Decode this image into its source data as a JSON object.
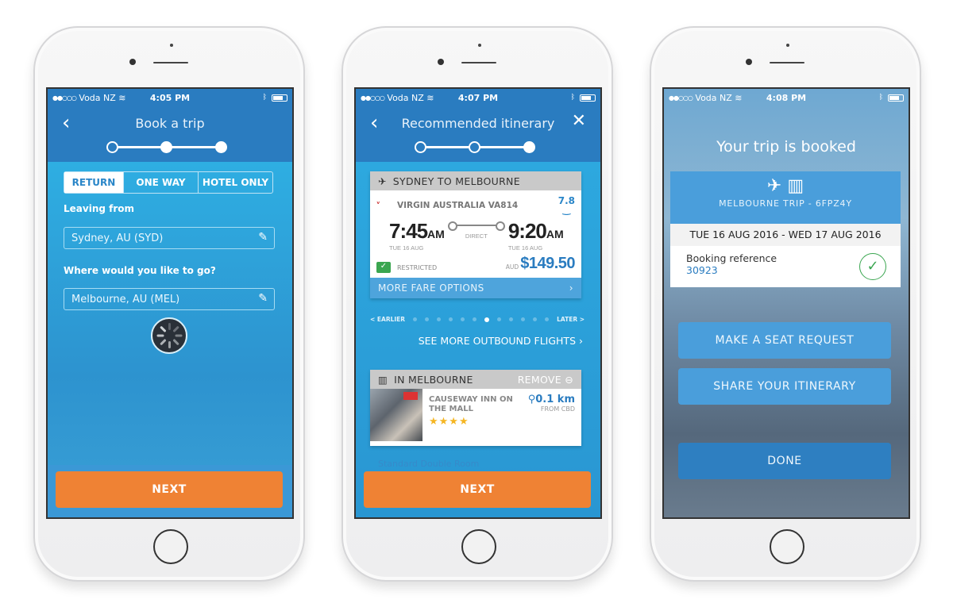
{
  "phones": [
    {
      "status": {
        "carrier": "Voda NZ",
        "time": "4:05 PM"
      },
      "nav": {
        "title": "Book a trip",
        "back_icon": "chevron-left"
      },
      "stepper": {
        "current_step": 1,
        "total_steps": 3
      },
      "trip_type": {
        "options": [
          "RETURN",
          "ONE WAY",
          "HOTEL ONLY"
        ],
        "selected": "RETURN"
      },
      "leaving_label": "Leaving from",
      "leaving_value": "Sydney, AU (SYD)",
      "destination_label": "Where would you like to go?",
      "destination_value": "Melbourne, AU (MEL)",
      "next_label": "NEXT"
    },
    {
      "status": {
        "carrier": "Voda NZ",
        "time": "4:07 PM"
      },
      "nav": {
        "title": "Recommended itinerary",
        "back_icon": "chevron-left",
        "close_icon": "close"
      },
      "stepper": {
        "current_step": 2,
        "total_steps": 3
      },
      "flight": {
        "header": "SYDNEY TO MELBOURNE",
        "airline": "VIRGIN AUSTRALIA VA814",
        "rating": "7.8",
        "depart_time": "7:45",
        "depart_ampm": "AM",
        "depart_date": "TUE 16 AUG",
        "stops": "DIRECT",
        "arrive_time": "9:20",
        "arrive_ampm": "AM",
        "arrive_date": "TUE 16 AUG",
        "fare_type": "RESTRICTED",
        "currency": "AUD",
        "price": "$149.50",
        "more_fares": "MORE FARE OPTIONS"
      },
      "pager": {
        "earlier": "< EARLIER",
        "later": "LATER >",
        "count": 12,
        "active_index": 6
      },
      "see_more": "SEE MORE OUTBOUND FLIGHTS",
      "hotel": {
        "header": "IN MELBOURNE",
        "remove": "REMOVE",
        "name": "CAUSEWAY INN ON THE MALL",
        "stars": "★★★★",
        "distance": "0.1",
        "distance_unit": "km",
        "distance_note": "FROM CBD",
        "room_type": "Standard Double Room"
      },
      "next_label": "NEXT"
    },
    {
      "status": {
        "carrier": "Voda NZ",
        "time": "4:08 PM"
      },
      "title": "Your trip is booked",
      "trip_name": "MELBOURNE TRIP - 6FPZ4Y",
      "dates": "TUE 16 AUG 2016 - WED 17 AUG 2016",
      "booking_ref_label": "Booking reference",
      "booking_ref_value": "30923",
      "seat_request": "MAKE A SEAT REQUEST",
      "share": "SHARE YOUR ITINERARY",
      "done": "DONE"
    }
  ]
}
